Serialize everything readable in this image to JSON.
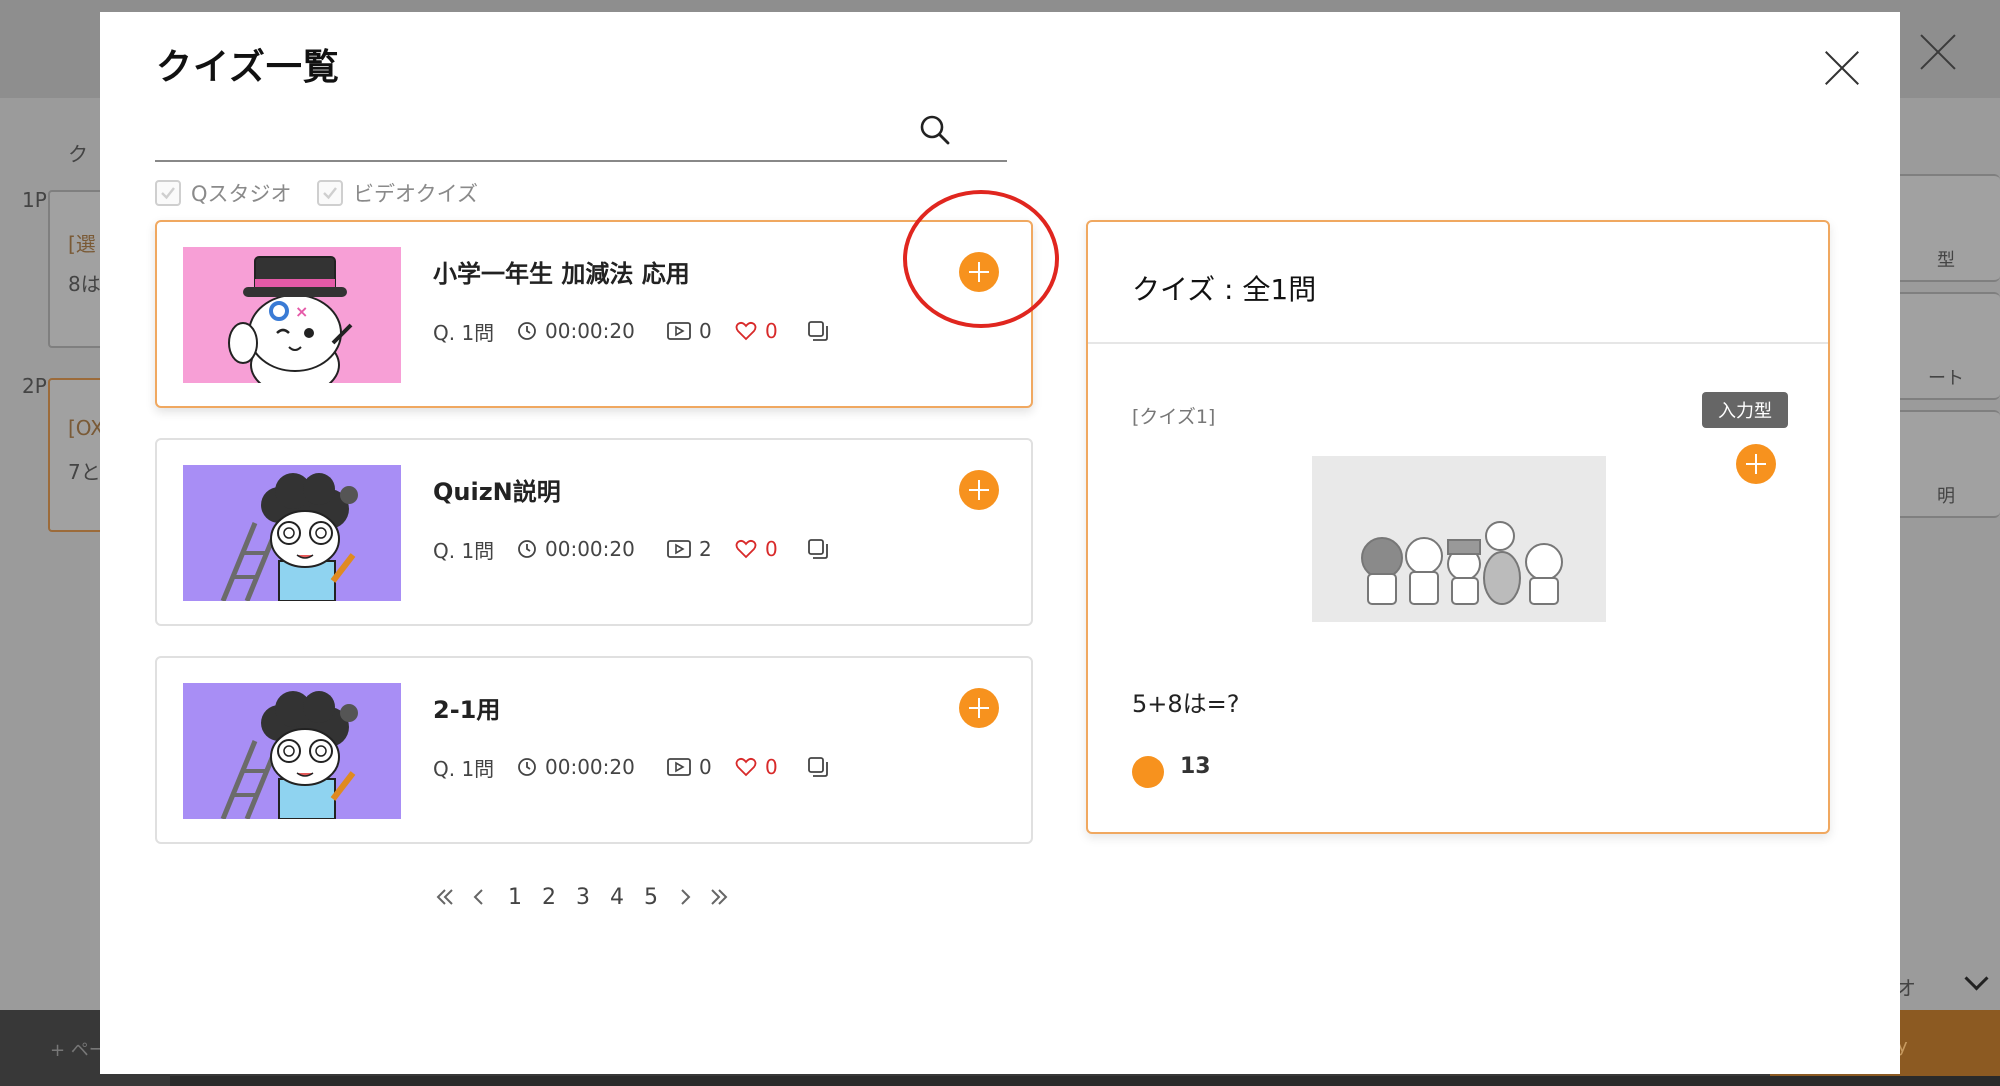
{
  "background": {
    "tab_partial": "ク",
    "page_labels": [
      "1P",
      "2P"
    ],
    "card1_tag": "[選",
    "card1_text": "8は",
    "card2_tag": "[OX",
    "card2_text": "7と",
    "right_tiles": [
      "型",
      "ート",
      "明"
    ],
    "right_bottom_text": "オ",
    "footer_add": "+ ペー",
    "footer_btn": "ay"
  },
  "modal": {
    "title": "クイズ一覧",
    "search_placeholder": "",
    "filters": [
      {
        "label": "Qスタジオ",
        "checked": true
      },
      {
        "label": "ビデオクイズ",
        "checked": true
      }
    ]
  },
  "quizzes": [
    {
      "title": "小学一年生 加減法 応用",
      "questions": "Q. 1問",
      "duration": "00:00:20",
      "plays": "0",
      "likes": "0",
      "selected": true,
      "thumb": "pink-magician"
    },
    {
      "title": "QuizN説明",
      "questions": "Q. 1問",
      "duration": "00:00:20",
      "plays": "2",
      "likes": "0",
      "selected": false,
      "thumb": "purple-scientist"
    },
    {
      "title": "2-1用",
      "questions": "Q. 1問",
      "duration": "00:00:20",
      "plays": "0",
      "likes": "0",
      "selected": false,
      "thumb": "purple-scientist"
    }
  ],
  "pagination": {
    "pages": [
      "1",
      "2",
      "3",
      "4",
      "5"
    ]
  },
  "preview": {
    "title": "クイズ : 全1問",
    "quiz_label": "[クイズ1]",
    "type_badge": "入力型",
    "question": "5+8は=?",
    "answer": "13"
  },
  "colors": {
    "accent": "#f7921e",
    "highlight": "#e0261f",
    "like": "#d82a2a"
  }
}
